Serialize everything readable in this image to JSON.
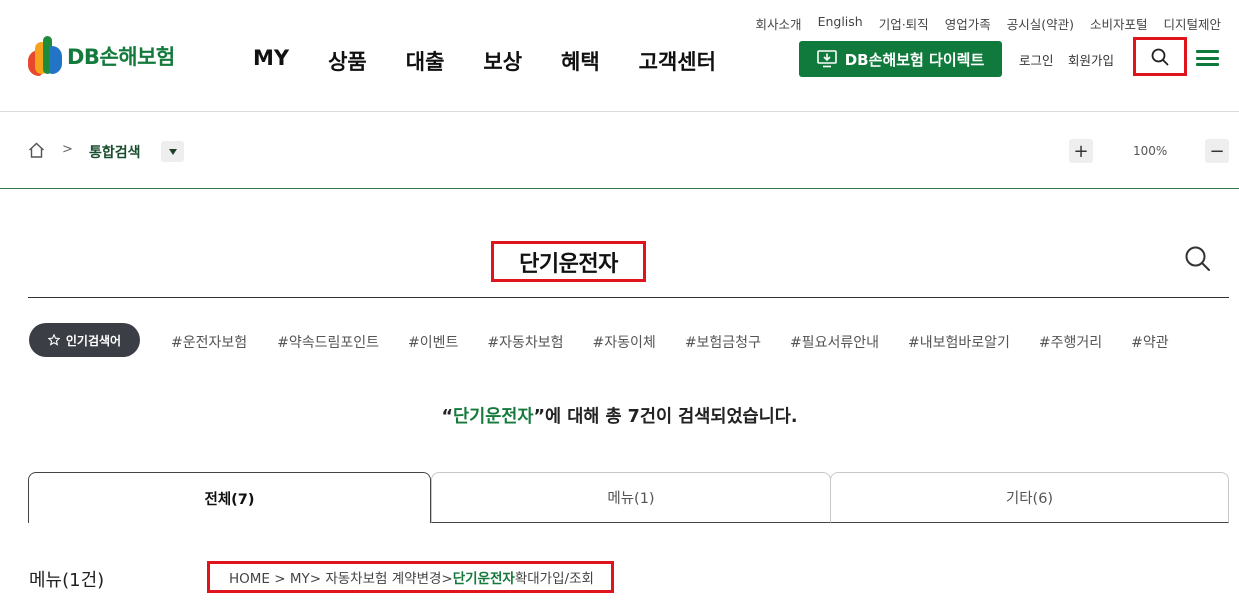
{
  "header": {
    "util_links": [
      "회사소개",
      "English",
      "기업·퇴직",
      "영업가족",
      "공시실(약관)",
      "소비자포털",
      "디지털제안"
    ],
    "logo_text": "DB손해보험",
    "nav": [
      "MY",
      "상품",
      "대출",
      "보상",
      "혜택",
      "고객센터"
    ],
    "direct_button": "DB손해보험 다이렉트",
    "login": "로그인",
    "join": "회원가입",
    "search_icon": "search-icon",
    "menu_icon": "hamburger-icon"
  },
  "breadcrumb": {
    "home_icon": "home-icon",
    "separator": ">",
    "current": "통합검색",
    "dropdown_icon": "caret-down-icon"
  },
  "zoom": {
    "plus": "+",
    "value": "100%",
    "minus": "−"
  },
  "search": {
    "query": "단기운전자",
    "popular_label": "인기검색어",
    "popular_tags": [
      "#운전자보험",
      "#약속드림포인트",
      "#이벤트",
      "#자동차보험",
      "#자동이체",
      "#보험금청구",
      "#필요서류안내",
      "#내보험바로알기",
      "#주행거리",
      "#약관"
    ],
    "summary_open_quote": "“",
    "summary_keyword": "단기운전자",
    "summary_rest": "”에 대해 총 7건이 검색되었습니다."
  },
  "tabs": [
    {
      "label": "전체(7)",
      "active": true
    },
    {
      "label": "메뉴(1)",
      "active": false
    },
    {
      "label": "기타(6)",
      "active": false
    }
  ],
  "results": {
    "section_label": "메뉴(1건)",
    "path_prefix": "HOME > MY> 자동차보험 계약변경> ",
    "path_keyword": "단기운전자",
    "path_suffix": "확대가입/조회"
  },
  "colors": {
    "brand_green": "#0f7a3b",
    "highlight_red": "#e0141d",
    "pill_dark": "#3b3e45"
  }
}
